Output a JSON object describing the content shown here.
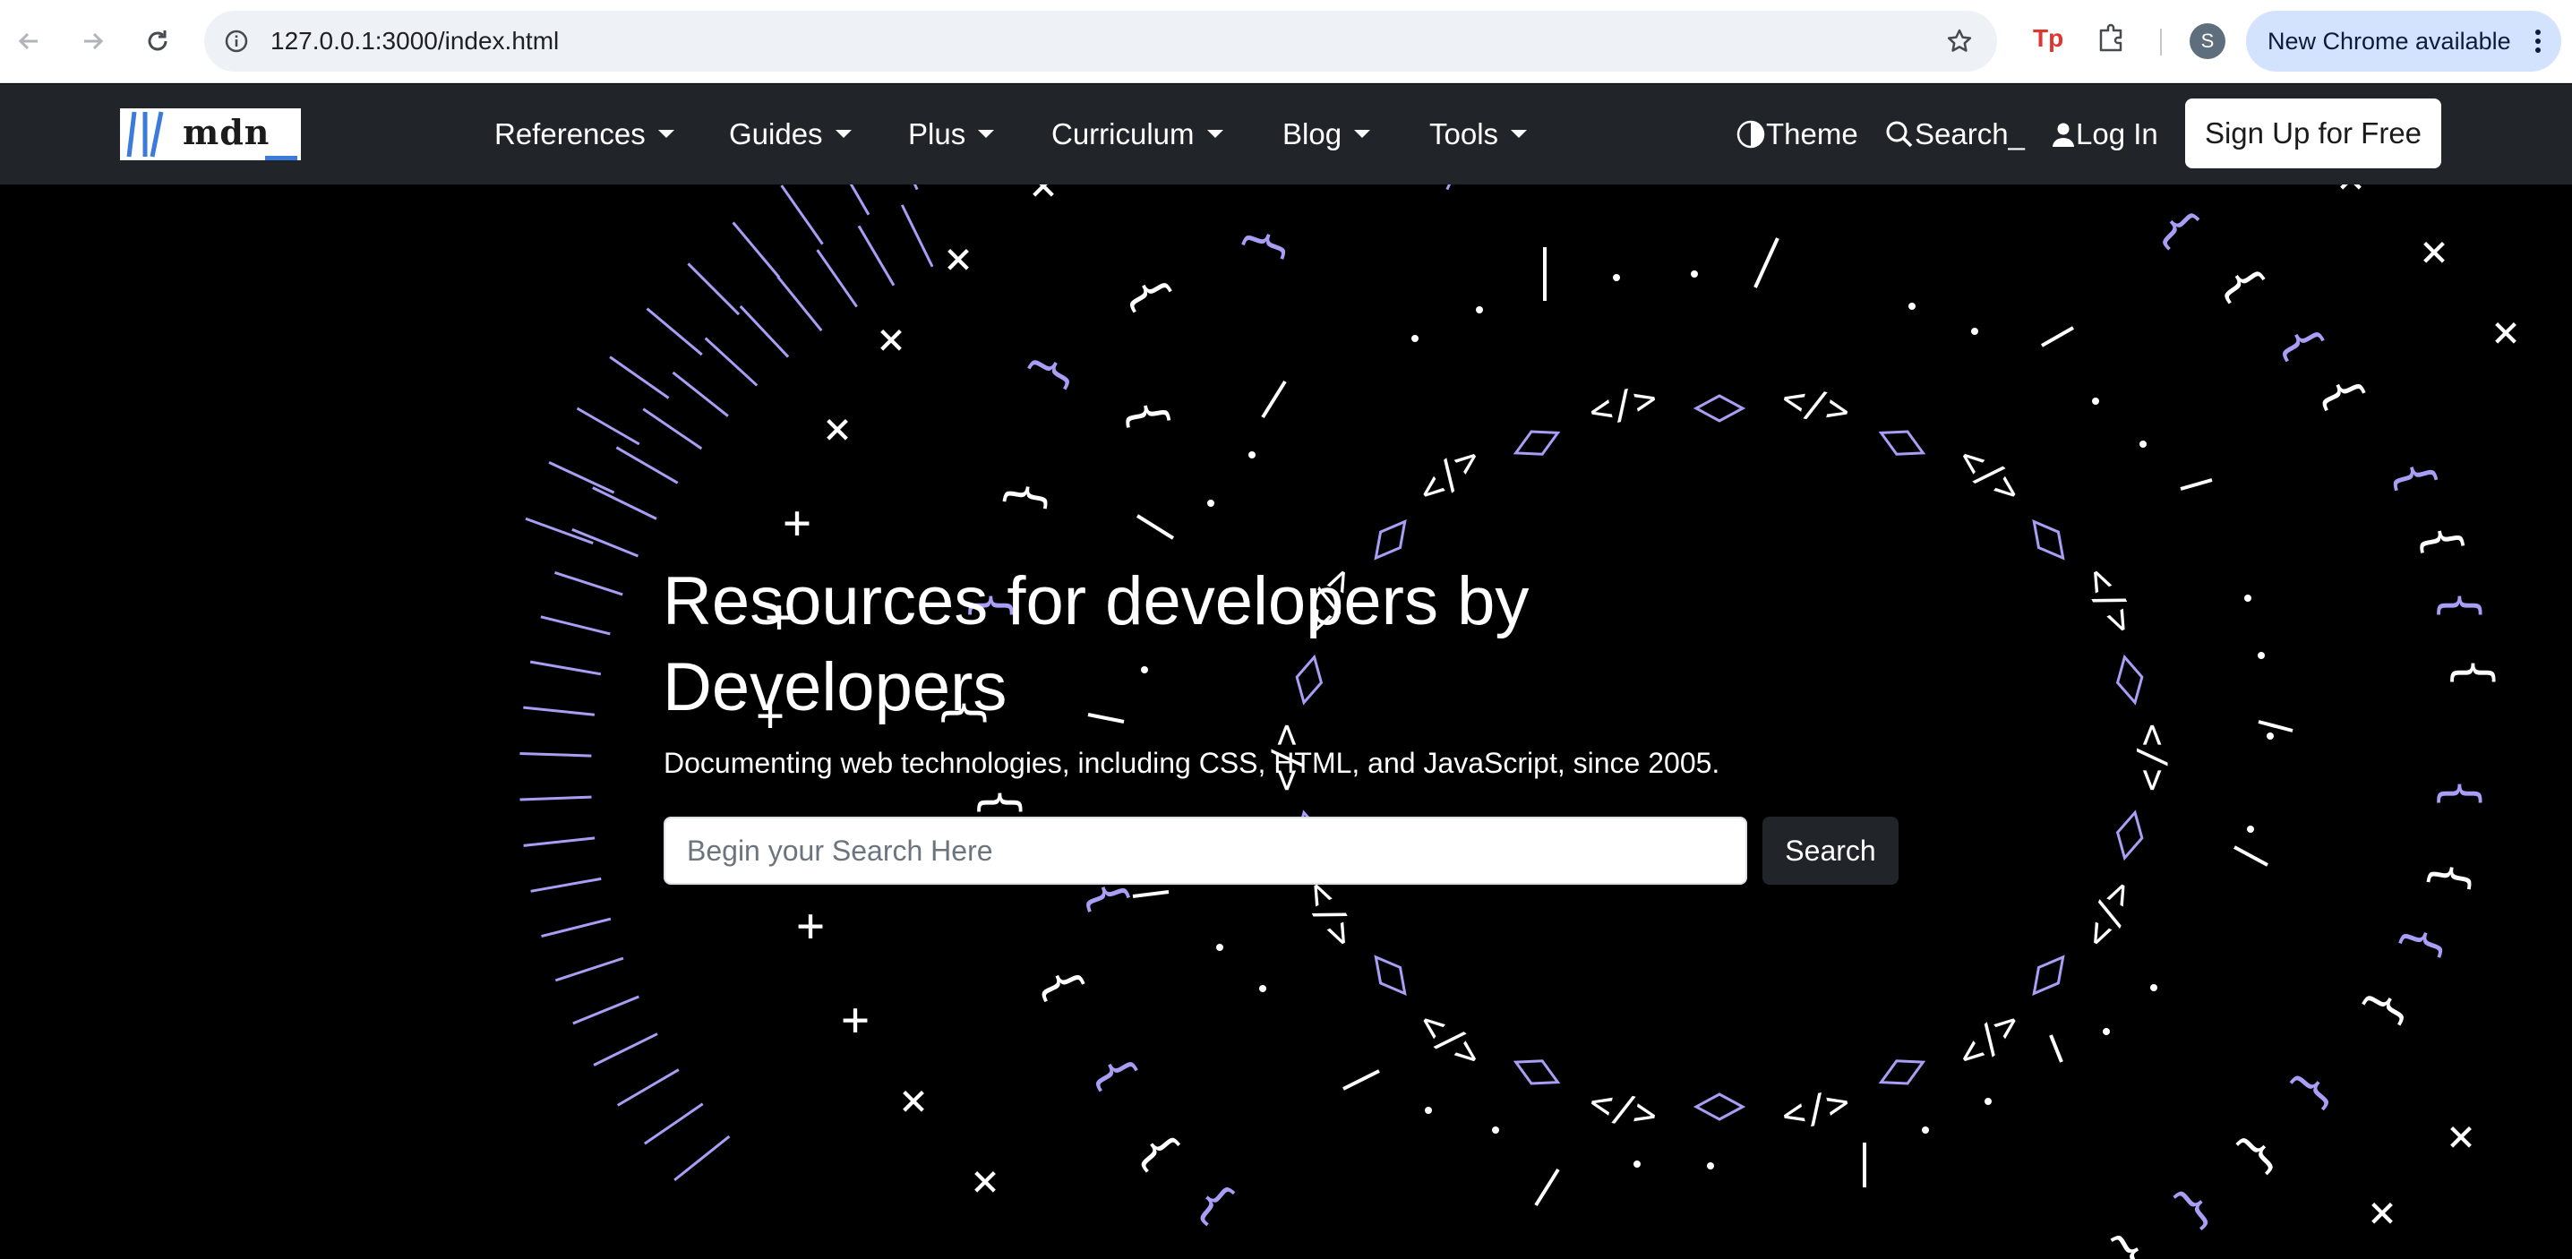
{
  "browser": {
    "url": "127.0.0.1:3000/index.html",
    "profile_initial": "S",
    "update_label": "New Chrome available",
    "icons": [
      "back-icon",
      "forward-icon",
      "reload-icon",
      "site-info-icon",
      "bookmark-star-icon",
      "tp-extension-icon",
      "extensions-puzzle-icon",
      "menu-dots-icon"
    ]
  },
  "site_nav": {
    "logo_text": "mdn",
    "menu": [
      {
        "label": "References"
      },
      {
        "label": "Guides"
      },
      {
        "label": "Plus"
      },
      {
        "label": "Curriculum"
      },
      {
        "label": "Blog"
      },
      {
        "label": "Tools"
      }
    ],
    "theme_label": "Theme",
    "search_label": "Search_",
    "login_label": "Log In",
    "signup_label": "Sign Up for Free"
  },
  "hero": {
    "title": "Resources for developers by Developers",
    "subtitle": "Documenting web technologies, including CSS, HTML, and JavaScript, since 2005.",
    "search_placeholder": "Begin your Search Here",
    "search_button": "Search"
  },
  "colors": {
    "nav_bg": "#212529",
    "hero_bg": "#000000",
    "accent_purple": "#a89ef5",
    "chrome_update_bg": "#d3e3fd"
  }
}
